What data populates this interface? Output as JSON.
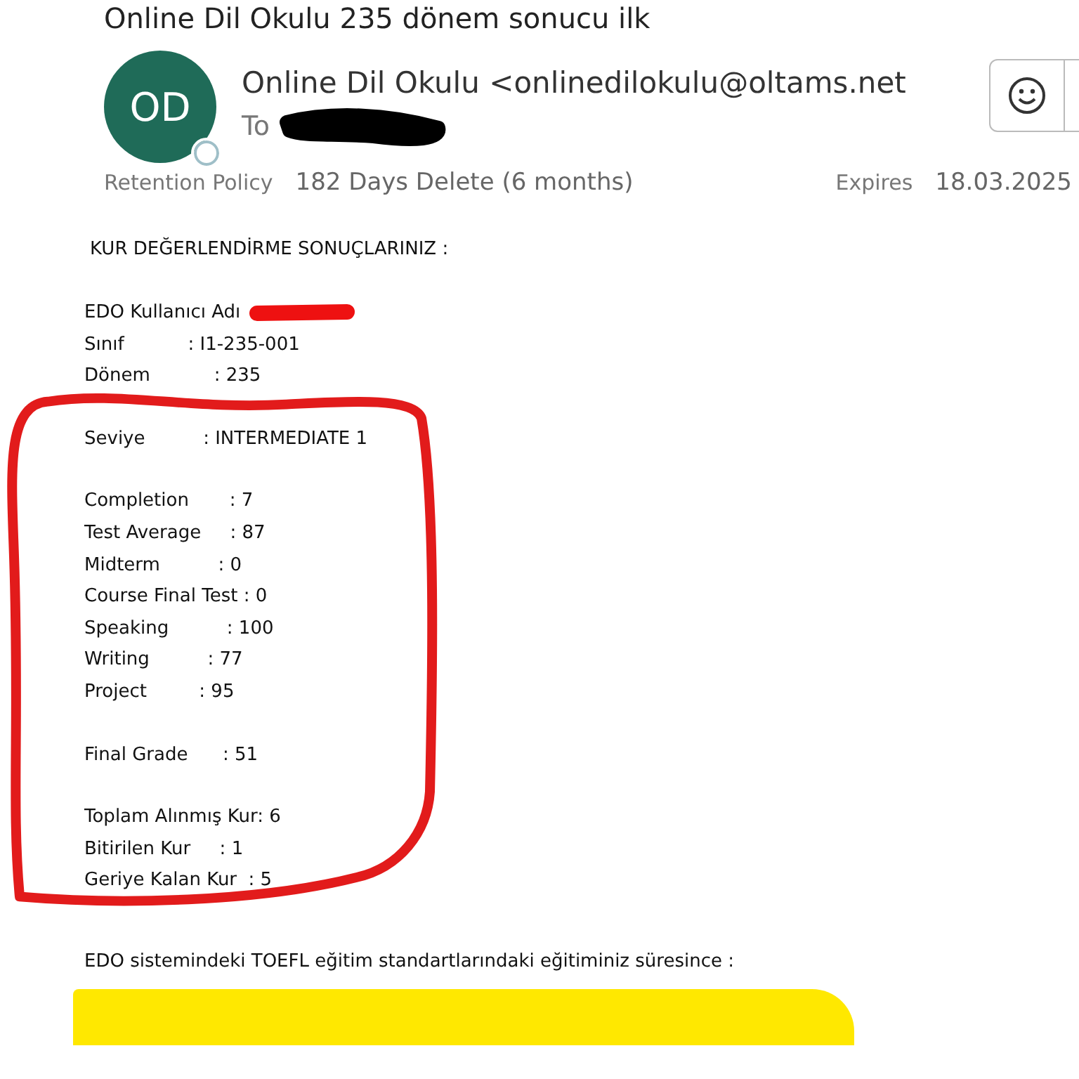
{
  "subject": "Online Dil Okulu 235 dönem sonucu ilk",
  "sender": {
    "initials": "OD",
    "name": "Online Dil Okulu <onlinedilokulu@oltams.net",
    "to_label": "To"
  },
  "retention": {
    "label": "Retention Policy",
    "value": "182 Days Delete (6 months)",
    "expires_label": "Expires",
    "expires_value": "18.03.2025"
  },
  "body": {
    "heading": "KUR DEĞERLENDİRME SONUÇLARINIZ :",
    "sections": [
      {
        "lines": [
          "EDO Kullanıcı Adı",
          "Sınıf           : I1-235-001",
          "Dönem           : 235"
        ]
      },
      {
        "lines": [
          "Seviye          : INTERMEDIATE 1"
        ]
      },
      {
        "lines": [
          "Completion       : 7",
          "Test Average     : 87",
          "Midterm          : 0",
          "Course Final Test : 0",
          "Speaking          : 100",
          "Writing          : 77",
          "Project         : 95"
        ]
      },
      {
        "lines": [
          "Final Grade      : 51"
        ]
      },
      {
        "lines": [
          "Toplam Alınmış Kur: 6",
          "Bitirilen Kur     : 1",
          "Geriye Kalan Kur  : 5"
        ]
      }
    ],
    "footer": "EDO sistemindeki TOEFL eğitim standartlarındaki eğitiminiz süresince :"
  }
}
